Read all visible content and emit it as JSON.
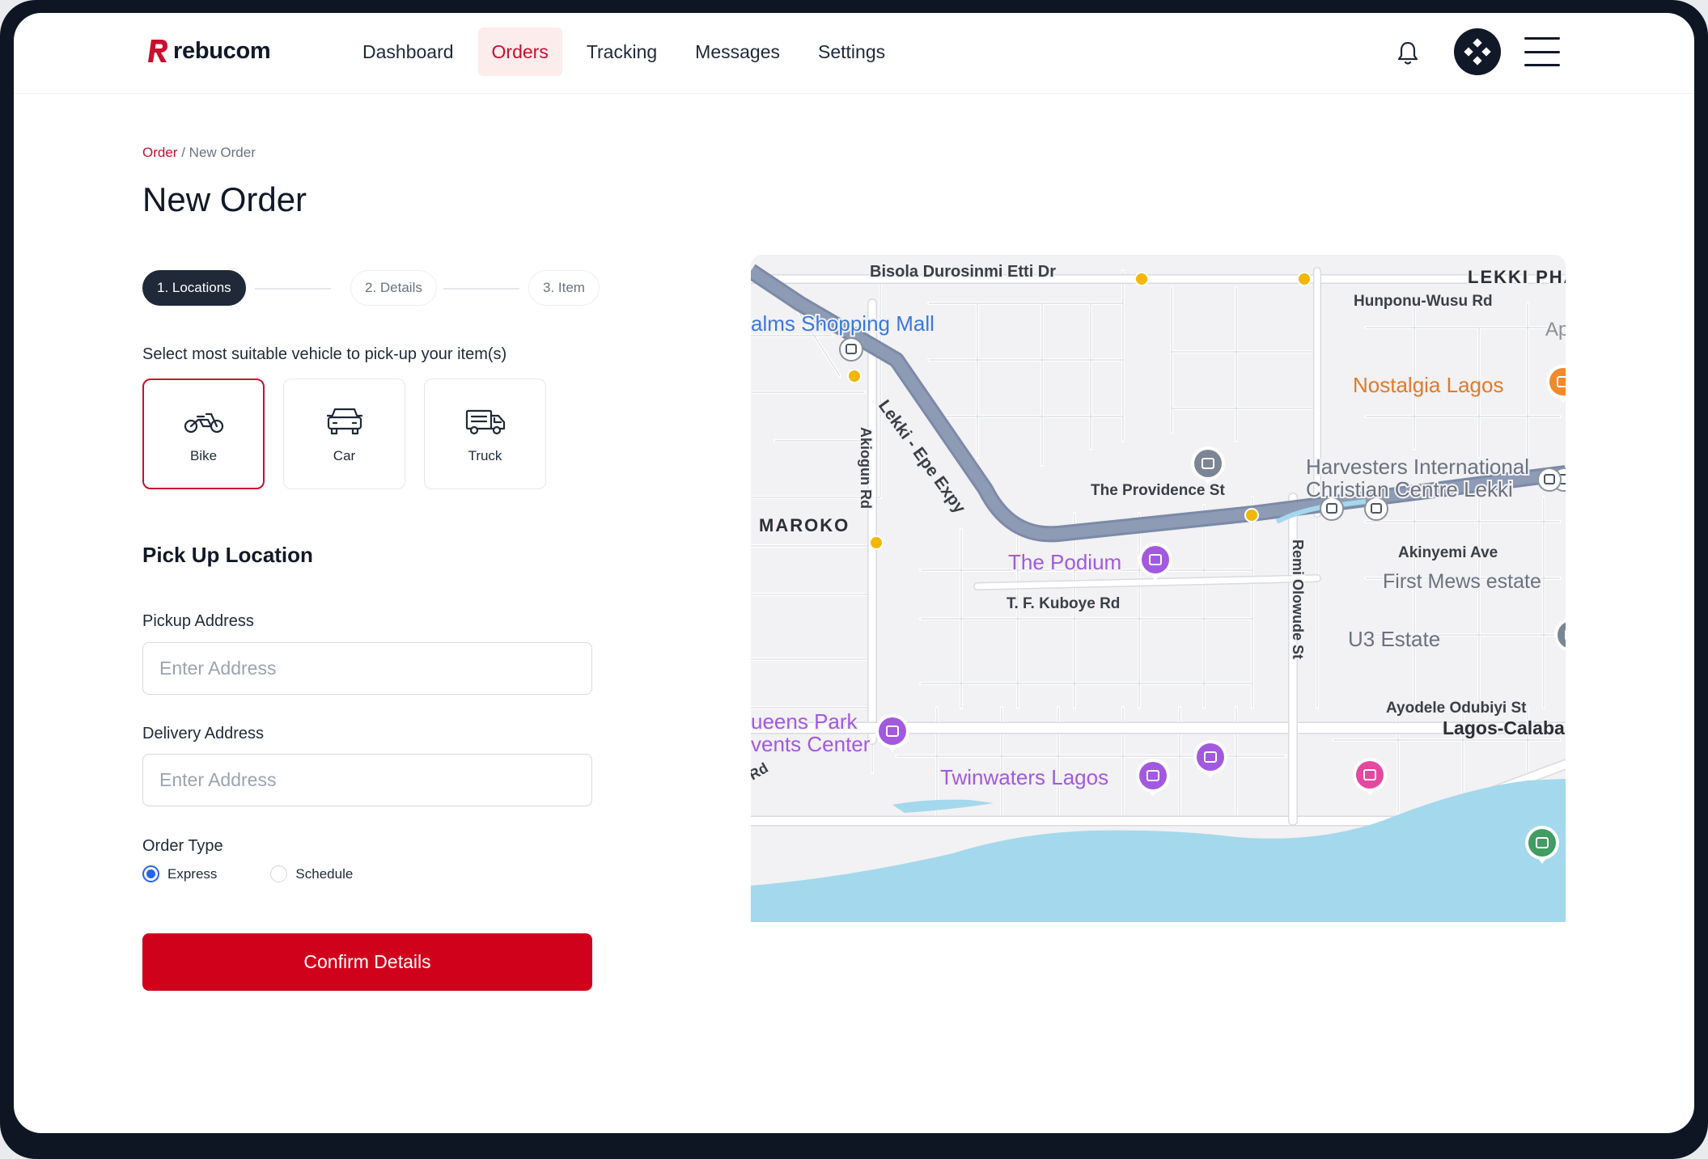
{
  "app": {
    "brand": "rebucom",
    "brand_color": "#c8102e"
  },
  "nav": {
    "items": [
      {
        "label": "Dashboard",
        "active": false
      },
      {
        "label": "Orders",
        "active": true
      },
      {
        "label": "Tracking",
        "active": false
      },
      {
        "label": "Messages",
        "active": false
      },
      {
        "label": "Settings",
        "active": false
      }
    ],
    "icons": {
      "notifications": "bell-icon",
      "avatar": "avatar-diamond-icon",
      "menu": "hamburger-menu-icon"
    }
  },
  "breadcrumb": {
    "root": "Order",
    "separator": "/",
    "current": "New Order"
  },
  "page": {
    "title": "New Order"
  },
  "steps": [
    {
      "label": "1. Locations",
      "active": true
    },
    {
      "label": "2. Details",
      "active": false
    },
    {
      "label": "3. Item",
      "active": false
    }
  ],
  "vehicle": {
    "prompt": "Select most suitable vehicle to pick-up your item(s)",
    "options": [
      {
        "label": "Bike",
        "icon": "motorcycle-icon",
        "selected": true
      },
      {
        "label": "Car",
        "icon": "car-icon",
        "selected": false
      },
      {
        "label": "Truck",
        "icon": "truck-icon",
        "selected": false
      }
    ]
  },
  "pickup": {
    "section_title": "Pick Up Location",
    "pickup_label": "Pickup Address",
    "pickup_placeholder": "Enter Address",
    "pickup_value": "",
    "delivery_label": "Delivery Address",
    "delivery_placeholder": "Enter Address",
    "delivery_value": ""
  },
  "order_type": {
    "label": "Order Type",
    "options": [
      {
        "label": "Express",
        "checked": true
      },
      {
        "label": "Schedule",
        "checked": false
      }
    ]
  },
  "actions": {
    "confirm_label": "Confirm Details"
  },
  "map": {
    "labels": {
      "bisola": "Bisola Durosinmi Etti Dr",
      "lekki_phase": "LEKKI PHA",
      "hunponu": "Hunponu-Wusu Rd",
      "ap": "Ap",
      "palms": "alms Shopping Mall",
      "nostalgia": "Nostalgia Lagos",
      "harvesters_1": "Harvesters International",
      "harvesters_2": "Christian Centre Lekki",
      "providence": "The Providence St",
      "maroko": "MAROKO",
      "akiogun": "Akiogun Rd",
      "expy": "Lekki - Epe Expy",
      "podium": "The Podium",
      "akinyemi": "Akinyemi Ave",
      "first_mews": "First Mews estate",
      "kuboye": "T. F. Kuboye Rd",
      "remi": "Remi Olowude St",
      "u3": "U3 Estate",
      "queens_1": "ueens Park",
      "queens_2": "vents Center",
      "ayodele": "Ayodele Odubiyi St",
      "lagos_calabar": "Lagos-Calaba",
      "rd_fragment": "Rd",
      "twinwaters": "Twinwaters Lagos"
    },
    "colors": {
      "land": "#f2f1f3",
      "road": "#ffffff",
      "road_edge": "#d8dbe0",
      "highway": "#8e9bb5",
      "water": "#a4d8ec",
      "poi_purple": "#a259e0",
      "poi_orange": "#f08a2b",
      "poi_gray": "#7b8594",
      "poi_pink": "#e5489f",
      "poi_green": "#3f9c62",
      "transit": "#f2b705"
    }
  }
}
